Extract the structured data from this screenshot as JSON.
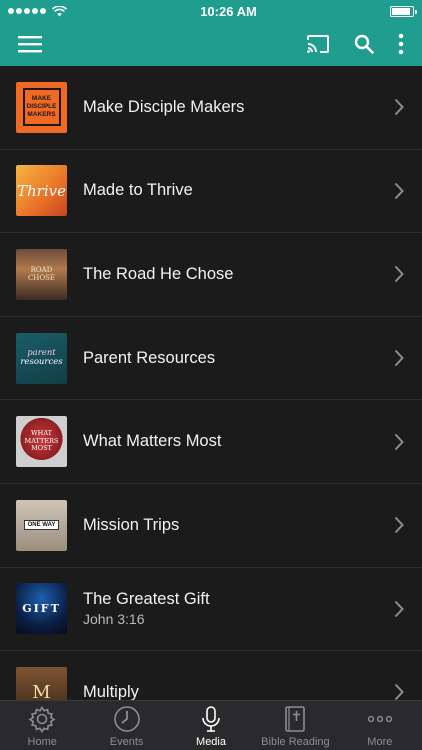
{
  "status": {
    "time": "10:26 AM"
  },
  "header": {
    "menu_icon": "hamburger-icon",
    "cast_icon": "cast-icon",
    "search_icon": "search-icon",
    "more_icon": "vertical-dots-icon",
    "accent": "#1f9e8f"
  },
  "series": [
    {
      "title": "Make Disciple Makers",
      "subtitle": "",
      "thumb_text": [
        "MAKE",
        "DISCIPLE",
        "MAKERS"
      ]
    },
    {
      "title": "Made to Thrive",
      "subtitle": "",
      "thumb_text": [
        "Thrive"
      ]
    },
    {
      "title": "The Road He Chose",
      "subtitle": "",
      "thumb_text": [
        "ROAD",
        "CHOSE"
      ]
    },
    {
      "title": "Parent Resources",
      "subtitle": "",
      "thumb_text": [
        "parent",
        "resources"
      ]
    },
    {
      "title": "What Matters Most",
      "subtitle": "",
      "thumb_text": [
        "WHAT",
        "MATTERS",
        "MOST"
      ]
    },
    {
      "title": "Mission Trips",
      "subtitle": "",
      "thumb_text": [
        "ONE WAY"
      ]
    },
    {
      "title": "The Greatest Gift",
      "subtitle": "John 3:16",
      "thumb_text": [
        "GIFT"
      ]
    },
    {
      "title": "Multiply",
      "subtitle": "",
      "thumb_text": [
        "M"
      ]
    }
  ],
  "tabs": [
    {
      "label": "Home",
      "icon": "gear-icon",
      "active": false
    },
    {
      "label": "Events",
      "icon": "clock-icon",
      "active": false
    },
    {
      "label": "Media",
      "icon": "microphone-icon",
      "active": true
    },
    {
      "label": "Bible Reading",
      "icon": "bible-icon",
      "active": false
    },
    {
      "label": "More",
      "icon": "ellipsis-icon",
      "active": false
    }
  ]
}
